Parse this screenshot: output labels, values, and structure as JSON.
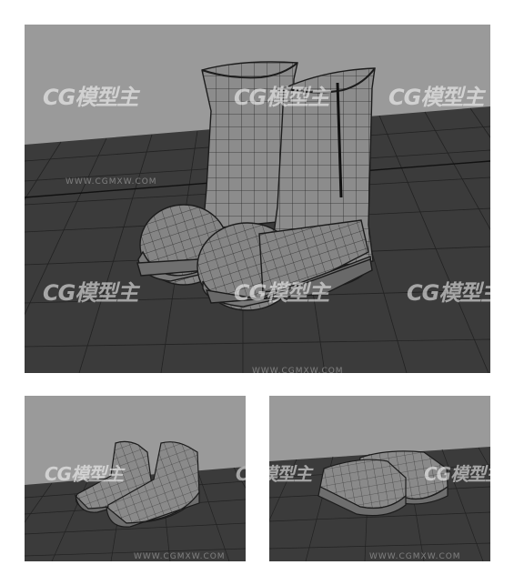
{
  "watermark": {
    "brand": "CG模型主",
    "url": "WWW.CGMXW.COM"
  },
  "colors": {
    "background": "#ffffff",
    "viewport_sky": "#9a9a9a",
    "floor": "#3b3b3b",
    "grid_line": "#1e1e1e",
    "model": "#8a8a8a",
    "wire": "#2a2a2a"
  },
  "panels": {
    "top": {
      "subject": "boots-model"
    },
    "bottom_left": {
      "subject": "low-shoes-model"
    },
    "bottom_right": {
      "subject": "flat-shoes-model"
    }
  }
}
